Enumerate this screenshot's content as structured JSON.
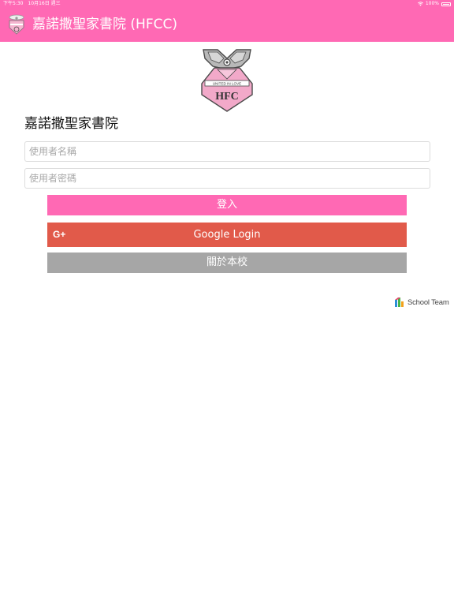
{
  "status_bar": {
    "time_date": "下午5:30　10月16日 週三",
    "battery_text": "100%",
    "icons": [
      "wifi-icon",
      "battery-icon"
    ]
  },
  "app_bar": {
    "title": "嘉諾撒聖家書院 (HFCC)",
    "background": "#ff69b4",
    "logo_icon": "school-logo-icon"
  },
  "crest": {
    "motto": "UNITED IN LOVE",
    "monogram": "HFC"
  },
  "login_form": {
    "school_name": "嘉諾撒聖家書院",
    "username": {
      "placeholder": "使用者名稱",
      "value": ""
    },
    "password": {
      "placeholder": "使用者密碼",
      "value": ""
    },
    "login_button": "登入",
    "google_button": "Google Login",
    "google_icon_text": "G+",
    "about_button": "關於本校"
  },
  "footer": {
    "brand": "School Team",
    "brand_icon": "school-team-logo-icon"
  },
  "colors": {
    "accent": "#ff69b4",
    "google": "#e15a4a",
    "about": "#a6a6a6"
  }
}
